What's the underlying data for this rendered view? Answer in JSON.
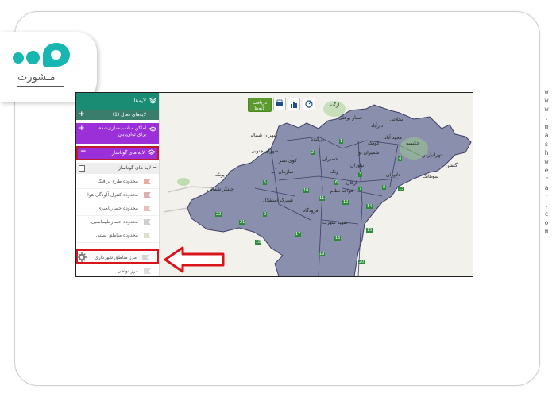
{
  "logo": {
    "text": "مـشورت"
  },
  "watermark": {
    "text": "www.mashwerat.com"
  },
  "panel": {
    "layers_header": "لایه‌ها",
    "active_layers": "لایه‌های فعال (1)",
    "places_header": "اماکن مناسب‌سازی‌شده برای توان‌یابان",
    "municipal_header": "لایه های گوناساز",
    "sub_header": "لایه های گوناساز",
    "items": [
      {
        "label": "محدوده طرح ترافیک",
        "color": "#d9534f"
      },
      {
        "label": "محدوده کنترل آلودگی هوا",
        "color": "#c06060"
      },
      {
        "label": "محدوده حصاربامبری",
        "color": "#d08080"
      },
      {
        "label": "محدوده حصارطهماسبی",
        "color": "#a0a0a0"
      },
      {
        "label": "محدوده مناطق بستی",
        "color": "#c0c0a0"
      }
    ],
    "highlighted_item": "مرز مناطق شهرداری",
    "last_item": "مرز نواحی"
  },
  "toolbar": {
    "receive_layer": "دریافت لایه‌ها",
    "print_icon": "printer-icon",
    "chart_icon": "chart-icon",
    "measure_icon": "measure-icon"
  },
  "map": {
    "labels": [
      "حصار بوعلی",
      "ازگنه",
      "دارآباد",
      "محلاتی",
      "تهرانپارس",
      "حکیمیه",
      "مجید آباد",
      "کوهک",
      "سوهانک",
      "شهران جنوبی",
      "زرگنده",
      "شهران شمالی",
      "کوی نصر",
      "نیاوران",
      "سازمان آب",
      "گلشن",
      "پونک",
      "ونک",
      "ارکان",
      "شهرک استقلال",
      "فرودگاه",
      "شهید شهرت",
      "چیتگر شمالی",
      "دلاوران",
      "خواجه نظام",
      "شمیران نو",
      "شمیران"
    ],
    "zones": [
      "1",
      "2",
      "3",
      "4",
      "5",
      "6",
      "7",
      "8",
      "9",
      "10",
      "11",
      "12",
      "13",
      "14",
      "15",
      "16",
      "17",
      "18",
      "19",
      "20",
      "21",
      "22"
    ]
  },
  "colors": {
    "green": "#1a8c73",
    "purple": "#9b30d9",
    "highlight": "#d9151b",
    "map_fill": "#8a8fad",
    "map_border": "#3d4066"
  }
}
